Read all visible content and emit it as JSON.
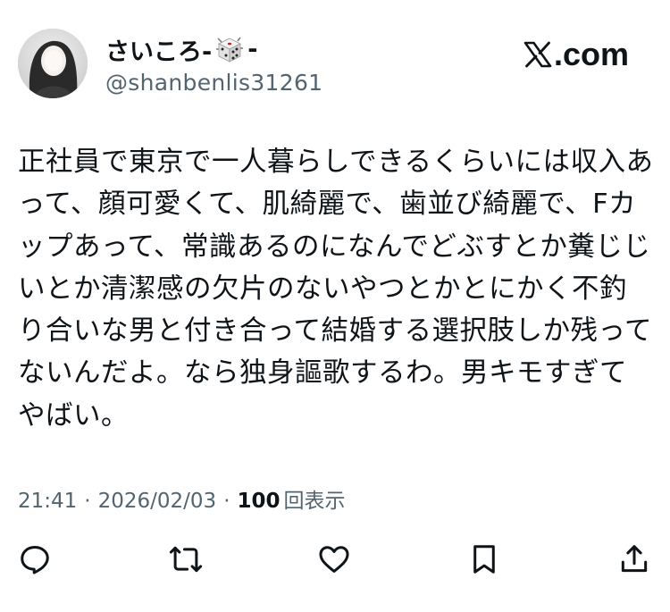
{
  "user": {
    "display_name": "さいころ-",
    "display_name_suffix": "-",
    "name_icon": "dice-icon",
    "handle": "@shanbenlis31261"
  },
  "brand": {
    "name": ".com",
    "logo": "x-logo-icon"
  },
  "post": {
    "text": "正社員で東京で一人暮らしできるくらいには収入あって、顔可愛くて、肌綺麗で、歯並び綺麗で、Fカップあって、常識あるのになんでどぶすとか糞じじいとか清潔感の欠片のないやつとかとにかく不釣り合いな男と付き合って結婚する選択肢しか残ってないんだよ。なら独身謳歌するわ。男キモすぎてやばい。"
  },
  "meta": {
    "time": "21:41",
    "date": "2026/02/03",
    "separator": "·",
    "views_count": "100",
    "views_label": "回表示"
  },
  "actions": [
    {
      "name": "reply",
      "icon": "reply-icon"
    },
    {
      "name": "repost",
      "icon": "repost-icon"
    },
    {
      "name": "like",
      "icon": "heart-icon"
    },
    {
      "name": "bookmark",
      "icon": "bookmark-icon"
    },
    {
      "name": "share",
      "icon": "share-icon"
    }
  ],
  "colors": {
    "text": "#0f1419",
    "secondary": "#536471",
    "background": "#ffffff"
  }
}
